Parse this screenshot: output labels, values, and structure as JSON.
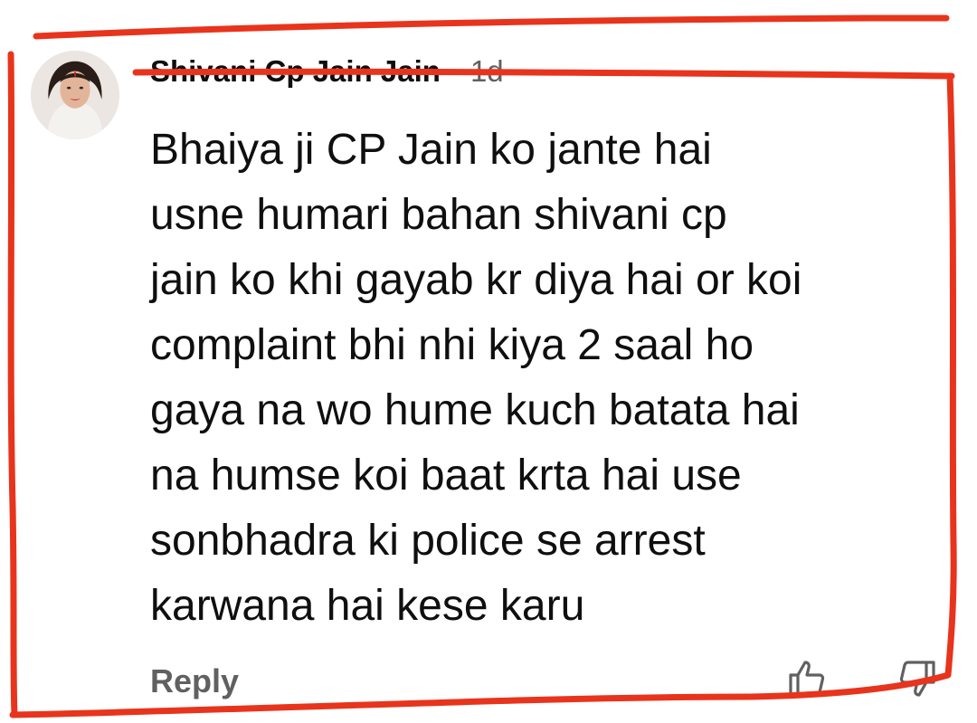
{
  "comment": {
    "author": "Shivani Cp Jain Jain",
    "separator": "·",
    "time": "1d",
    "body_lines": [
      "Bhaiya ji CP Jain ko jante hai",
      "usne humari bahan shivani cp",
      "jain ko khi gayab kr diya hai or koi",
      "complaint bhi nhi kiya 2 saal ho",
      "gaya na wo hume kuch batata hai",
      "na humse koi baat krta hai use",
      "sonbhadra ki police se arrest",
      "karwana hai kese karu"
    ],
    "reply_label": "Reply",
    "avatar_icon": "profile-photo",
    "like_icon": "thumbs-up-icon",
    "dislike_icon": "thumbs-down-icon"
  },
  "colors": {
    "annotation": "#e8341c",
    "text": "#0f0f0f",
    "secondary_text": "#606060"
  }
}
